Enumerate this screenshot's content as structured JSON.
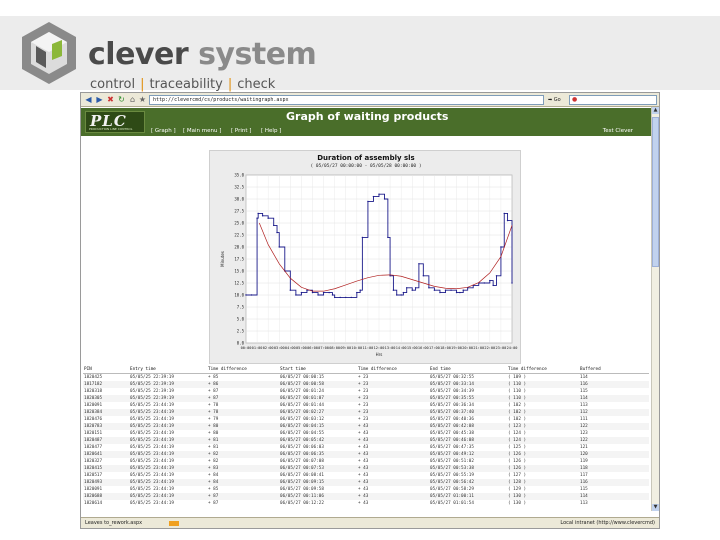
{
  "slide": {
    "brand_primary": "clever",
    "brand_secondary": "system",
    "tagline": [
      "control",
      "traceability",
      "check"
    ],
    "tagline_separator": "|"
  },
  "browser": {
    "url": "http://clevercmd/cs/products/waitingraph.aspx",
    "go_label": "Go",
    "status_left": "Leaves to_rework.aspx",
    "status_right": "Local intranet (http://www.clevercmd)"
  },
  "app": {
    "logo_text": "PLC",
    "logo_subtext": "PRODUCTION LINE CONTROL",
    "title": "Graph of waiting products",
    "nav": [
      "[ Graph ]",
      "[ Main menu ]",
      "[ Print ]",
      "[ Help ]"
    ],
    "user": "Test Clever"
  },
  "colors": {
    "header_green": "#4a6e2a",
    "series_line": "#1a1a8a",
    "trend_line": "#b02020",
    "accent_orange": "#e09010"
  },
  "chart_data": {
    "type": "line",
    "title": "Duration of assembly sls",
    "subtitle": "( 05/05/27 00:00:00 - 05/05/28 00:00:00 )",
    "xlabel": "Hrs",
    "ylabel": "Minutes",
    "ylim": [
      0,
      35
    ],
    "yticks": [
      0,
      2.5,
      5,
      7.5,
      10,
      12.5,
      15,
      17.5,
      20,
      22.5,
      25,
      27.5,
      30,
      32.5,
      35
    ],
    "ytick_labels": [
      "0.0",
      "2.5",
      "5.0",
      "7.5",
      "10.0",
      "12.5",
      "15.0",
      "17.5",
      "20.0",
      "22.5",
      "25.0",
      "27.5",
      "30.0",
      "32.5",
      "35.0"
    ],
    "xlim": [
      0,
      24
    ],
    "xticks": [
      0,
      1,
      2,
      3,
      4,
      5,
      6,
      7,
      8,
      9,
      10,
      11,
      12,
      13,
      14,
      15,
      16,
      17,
      18,
      19,
      20,
      21,
      22,
      23,
      24
    ],
    "xtick_labels": [
      "00:00",
      "01:00",
      "02:00",
      "03:00",
      "04:00",
      "05:00",
      "06:00",
      "07:00",
      "08:00",
      "09:00",
      "10:00",
      "11:00",
      "12:00",
      "13:00",
      "14:00",
      "15:00",
      "16:00",
      "17:00",
      "18:00",
      "19:00",
      "20:00",
      "21:00",
      "22:00",
      "23:00",
      "24:00"
    ],
    "grid": true,
    "series": [
      {
        "x": [
          0,
          0.5,
          1.0,
          1.1,
          1.5,
          2.0,
          2.5,
          2.8,
          3.0,
          3.5,
          4.0,
          4.5,
          5.0,
          5.5,
          6.0,
          6.5,
          7.0,
          7.5,
          7.8,
          8.0,
          8.5,
          9.0,
          9.5,
          10.0,
          10.3,
          10.5,
          11.0,
          11.5,
          12.0,
          12.5,
          12.8,
          13.0,
          13.3,
          13.6,
          14.0,
          14.2,
          14.5,
          15.0,
          15.3,
          15.6,
          16.0,
          16.5,
          17.0,
          17.5,
          18.0,
          18.5,
          19.0,
          19.3,
          19.6,
          20.0,
          20.5,
          21.0,
          21.5,
          22.0,
          22.3,
          22.6,
          23.0,
          23.3,
          23.6,
          24.0
        ],
        "y": [
          10.0,
          10.0,
          26.0,
          27.0,
          26.5,
          26.0,
          24.5,
          23.0,
          20.0,
          15.0,
          11.0,
          10.0,
          10.5,
          11.0,
          10.5,
          10.0,
          10.5,
          10.5,
          10.0,
          9.5,
          9.5,
          9.5,
          9.5,
          10.5,
          11.0,
          22.0,
          29.5,
          30.5,
          31.0,
          30.0,
          22.0,
          14.0,
          11.0,
          10.0,
          10.0,
          10.5,
          11.5,
          11.0,
          11.5,
          16.5,
          14.0,
          11.5,
          11.0,
          10.5,
          11.0,
          11.0,
          10.5,
          10.5,
          11.0,
          11.5,
          12.0,
          12.5,
          12.5,
          13.0,
          12.0,
          14.0,
          20.0,
          27.0,
          25.5,
          12.5
        ]
      },
      {
        "x": [
          1.2,
          2,
          3,
          4,
          5,
          6,
          7,
          8,
          9,
          10,
          11,
          12,
          13,
          14,
          15,
          16,
          17,
          18,
          19,
          20,
          21,
          22,
          23,
          24
        ],
        "y": [
          25.0,
          20.5,
          16.5,
          13.5,
          11.6,
          10.8,
          10.8,
          11.3,
          12.1,
          12.9,
          13.6,
          14.1,
          14.2,
          13.9,
          13.2,
          12.5,
          11.8,
          11.4,
          11.3,
          11.6,
          12.6,
          14.6,
          18.0,
          24.5
        ]
      }
    ]
  },
  "table": {
    "headers": [
      "PIN",
      "Entry time",
      "Time difference",
      "Start time",
      "Time difference",
      "End time",
      "Time difference",
      "Buffered"
    ],
    "rows": [
      [
        "1820425",
        "05/05/25 22:39:19",
        "+ 85",
        "06/05/27 00:00:15",
        "+ 23",
        "05/05/27 00:32:55",
        "( 109 )",
        "114"
      ],
      [
        "1817182",
        "05/05/25 22:39:19",
        "+ 86",
        "06/05/27 00:00:58",
        "+ 23",
        "05/05/27 00:33:14",
        "( 110 )",
        "116"
      ],
      [
        "1820318",
        "05/05/25 22:39:19",
        "+ 87",
        "06/05/27 00:01:24",
        "+ 23",
        "05/05/27 00:34:39",
        "( 110 )",
        "115"
      ],
      [
        "1820305",
        "05/05/25 22:39:19",
        "+ 87",
        "06/05/27 00:01:07",
        "+ 23",
        "05/05/27 00:35:55",
        "( 110 )",
        "114"
      ],
      [
        "1820091",
        "05/05/25 23:44:19",
        "+ 78",
        "06/05/27 00:01:44",
        "+ 23",
        "05/05/27 00:36:34",
        "( 102 )",
        "113"
      ],
      [
        "1820384",
        "05/05/25 23:44:19",
        "+ 78",
        "06/05/27 00:02:27",
        "+ 23",
        "05/05/27 00:37:40",
        "( 102 )",
        "112"
      ],
      [
        "1820476",
        "05/05/25 23:44:19",
        "+ 79",
        "06/05/27 00:03:12",
        "+ 23",
        "05/05/27 00:40:36",
        "( 102 )",
        "111"
      ],
      [
        "1820783",
        "05/05/25 23:44:19",
        "+ 80",
        "06/05/27 00:04:15",
        "+ 43",
        "05/05/27 00:42:08",
        "( 123 )",
        "122"
      ],
      [
        "1820151",
        "05/05/25 23:44:19",
        "+ 80",
        "06/05/27 00:04:55",
        "+ 43",
        "05/05/27 00:45:38",
        "( 124 )",
        "123"
      ],
      [
        "1820487",
        "05/05/25 23:44:19",
        "+ 81",
        "06/05/27 00:05:42",
        "+ 43",
        "05/05/27 00:46:08",
        "( 124 )",
        "122"
      ],
      [
        "1820477",
        "05/05/25 23:44:19",
        "+ 81",
        "06/05/27 00:06:03",
        "+ 43",
        "05/05/27 00:47:35",
        "( 125 )",
        "121"
      ],
      [
        "1820641",
        "05/05/25 23:44:19",
        "+ 82",
        "06/05/27 00:06:35",
        "+ 43",
        "05/05/27 00:49:12",
        "( 126 )",
        "120"
      ],
      [
        "1820327",
        "05/05/25 23:44:19",
        "+ 82",
        "06/05/27 00:07:08",
        "+ 43",
        "05/05/27 00:51:02",
        "( 126 )",
        "119"
      ],
      [
        "1820415",
        "05/05/25 23:44:19",
        "+ 83",
        "06/05/27 00:07:53",
        "+ 43",
        "05/05/27 00:53:38",
        "( 126 )",
        "118"
      ],
      [
        "1820517",
        "05/05/25 23:44:19",
        "+ 84",
        "06/05/27 00:08:41",
        "+ 43",
        "05/05/27 00:55:19",
        "( 127 )",
        "117"
      ],
      [
        "1820493",
        "05/05/25 23:44:19",
        "+ 84",
        "06/05/27 00:09:15",
        "+ 43",
        "05/05/27 00:56:42",
        "( 128 )",
        "116"
      ],
      [
        "1820091",
        "05/05/25 23:44:19",
        "+ 85",
        "06/05/27 00:09:58",
        "+ 43",
        "05/05/27 00:58:29",
        "( 129 )",
        "115"
      ],
      [
        "1820688",
        "05/05/25 23:44:19",
        "+ 87",
        "06/05/27 00:11:06",
        "+ 43",
        "05/05/27 01:00:11",
        "( 130 )",
        "114"
      ],
      [
        "1820614",
        "05/05/25 23:44:19",
        "+ 87",
        "06/05/27 00:12:22",
        "+ 43",
        "05/05/27 01:01:54",
        "( 130 )",
        "113"
      ]
    ]
  }
}
